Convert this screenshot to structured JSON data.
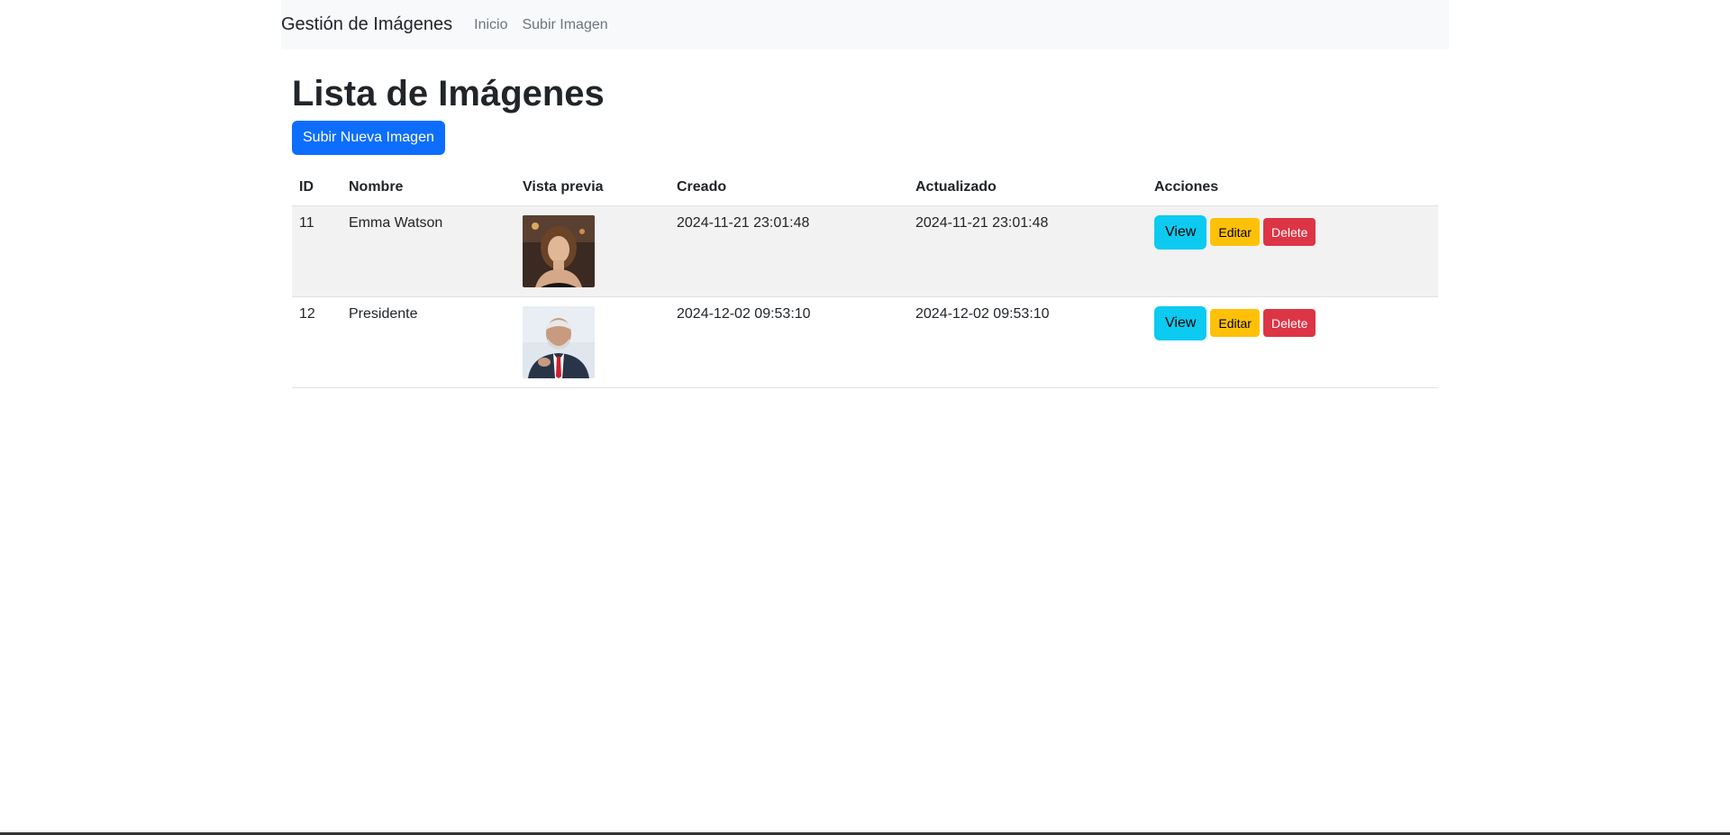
{
  "navbar": {
    "brand": "Gestión de Imágenes",
    "links": [
      "Inicio",
      "Subir Imagen"
    ]
  },
  "page": {
    "title": "Lista de Imágenes",
    "upload_button": "Subir Nueva Imagen"
  },
  "table": {
    "headers": [
      "ID",
      "Nombre",
      "Vista previa",
      "Creado",
      "Actualizado",
      "Acciones"
    ],
    "rows": [
      {
        "id": "11",
        "name": "Emma Watson",
        "created": "2024-11-21 23:01:48",
        "updated": "2024-11-21 23:01:48",
        "view": "View",
        "edit": "Editar",
        "delete": "Delete"
      },
      {
        "id": "12",
        "name": "Presidente",
        "created": "2024-12-02 09:53:10",
        "updated": "2024-12-02 09:53:10",
        "view": "View",
        "edit": "Editar",
        "delete": "Delete"
      }
    ]
  },
  "colors": {
    "primary": "#0d6efd",
    "info": "#0dcaf0",
    "warning": "#ffc107",
    "danger": "#dc3545"
  }
}
